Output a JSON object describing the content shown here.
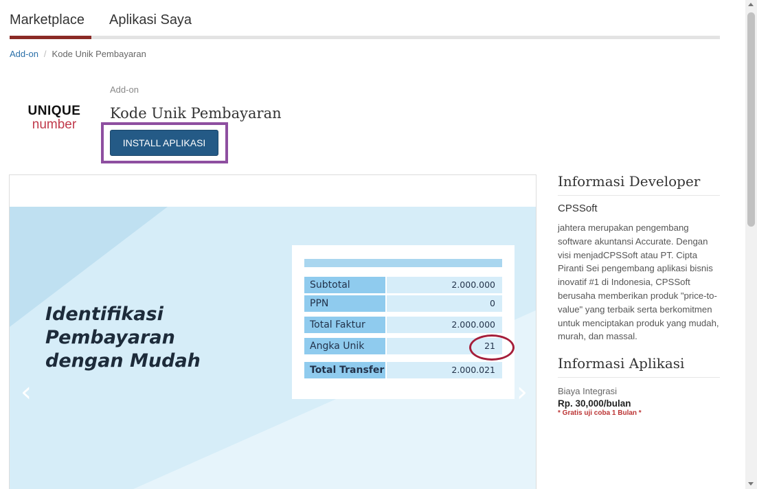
{
  "tabs": {
    "marketplace": "Marketplace",
    "my_apps": "Aplikasi Saya"
  },
  "breadcrumb": {
    "parent": "Add-on",
    "separator": "/",
    "current": "Kode Unik Pembayaran"
  },
  "app": {
    "logo_line1": "UNIQUE",
    "logo_line2": "number",
    "category": "Add-on",
    "title": "Kode Unik Pembayaran",
    "install_label": "INSTALL APLIKASI"
  },
  "slide": {
    "heading_line1": "Identifikasi Pembayaran",
    "heading_line2": "dengan Mudah",
    "rows": [
      {
        "label": "Subtotal",
        "value": "2.000.000"
      },
      {
        "label": "PPN",
        "value": "0"
      },
      {
        "label": "Total Faktur",
        "value": "2.000.000"
      },
      {
        "label": "Angka Unik",
        "value": "21"
      },
      {
        "label": "Total Transfer",
        "value": "2.000.021"
      }
    ],
    "prev_arrow": "‹",
    "next_arrow": "›"
  },
  "developer": {
    "heading": "Informasi Developer",
    "name": "CPSSoft",
    "description": "jahtera merupakan pengembang software akuntansi Accurate. Dengan visi menjadCPSSoft atau PT. Cipta Piranti Sei pengembang aplikasi bisnis inovatif #1 di Indonesia, CPSSoft berusaha memberikan produk \"price-to-value\" yang terbaik serta berkomitmen untuk menciptakan produk yang mudah, murah, dan massal."
  },
  "app_info": {
    "heading": "Informasi Aplikasi",
    "cost_label": "Biaya Integrasi",
    "price": "Rp. 30,000/bulan",
    "trial": "* Gratis uji coba 1 Bulan *"
  },
  "colors": {
    "tab_active": "#8b2a26",
    "install_button": "#245a86",
    "highlight_frame": "#8e4fa0",
    "unik_circle": "#a51e3a",
    "link": "#2a6fa8"
  }
}
